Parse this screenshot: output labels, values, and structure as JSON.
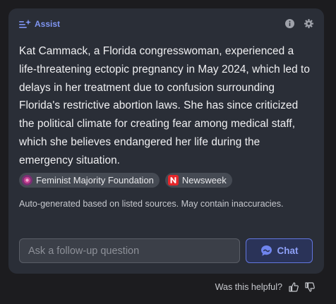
{
  "assist": {
    "label": "Assist",
    "accent": "#7f95f2",
    "icons": [
      "sparkle-list-icon",
      "info-icon",
      "gear-icon"
    ]
  },
  "summary": {
    "text": "Kat Cammack, a Florida congresswoman, experienced a life-threatening ectopic pregnancy in May 2024, which led to delays in her treatment due to confusion surrounding Florida's restrictive abortion laws. She has since criticized the political climate for creating fear among medical staff, which she believes endangered her life during the emergency situation."
  },
  "sources": [
    {
      "label": "Feminist Majority Foundation",
      "icon": "feminist-majority-logo-icon"
    },
    {
      "label": "Newsweek",
      "icon": "newsweek-logo-icon"
    }
  ],
  "disclaimer": "Auto-generated based on listed sources. May contain inaccuracies.",
  "followup": {
    "placeholder": "Ask a follow-up question",
    "value": ""
  },
  "chat_button": {
    "label": "Chat",
    "icon": "chat-bubble-icon",
    "color": "#6276df"
  },
  "feedback": {
    "question": "Was this helpful?",
    "icons": [
      "thumbs-up-icon",
      "thumbs-down-icon"
    ]
  }
}
